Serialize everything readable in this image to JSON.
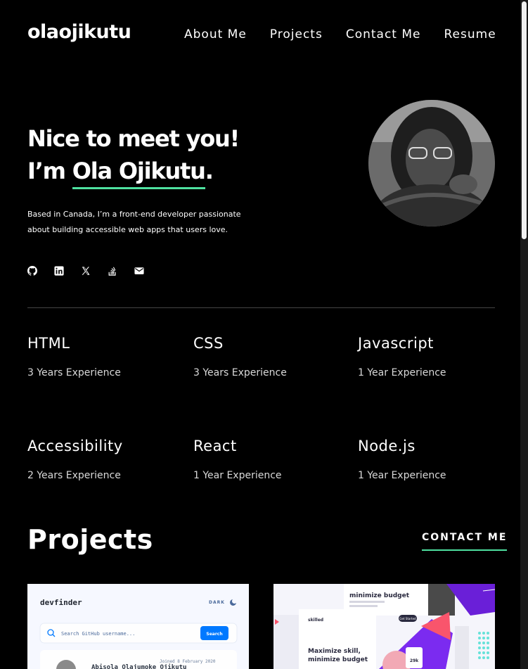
{
  "header": {
    "logo": "olaojikutu",
    "nav": [
      "About Me",
      "Projects",
      "Contact Me",
      "Resume"
    ]
  },
  "hero": {
    "line1": "Nice to meet you!",
    "line2_prefix": "I’m ",
    "name": "Ola Ojikutu",
    "line2_suffix": ".",
    "bio": "Based in Canada, I’m a front-end developer passionate about building accessible web apps that users love."
  },
  "socials": [
    "github-icon",
    "linkedin-icon",
    "x-icon",
    "stackoverflow-icon",
    "email-icon"
  ],
  "skills": [
    {
      "name": "HTML",
      "experience": "3 Years Experience"
    },
    {
      "name": "CSS",
      "experience": "3 Years Experience"
    },
    {
      "name": "Javascript",
      "experience": "1 Year Experience"
    },
    {
      "name": "Accessibility",
      "experience": "2 Years Experience"
    },
    {
      "name": "React",
      "experience": "1 Year Experience"
    },
    {
      "name": "Node.js",
      "experience": "1 Year Experience"
    }
  ],
  "projects": {
    "title": "Projects",
    "contact_label": "CONTACT ME",
    "card1": {
      "brand": "devfinder",
      "theme": "DARK",
      "search_placeholder": "Search GitHub username...",
      "search_button": "Search",
      "joined": "Joined 8 February 2020",
      "user_name": "Abisola Olajumoke Ojikutu"
    },
    "card2": {
      "brand": "skilled",
      "cta": "Get Started",
      "headline1": "Maximize skill,",
      "headline2": "minimize budget",
      "top_heading": "minimize budget",
      "stat": "29k"
    }
  },
  "colors": {
    "accent": "#4ee1a0",
    "background": "#000000",
    "text": "#ffffff"
  }
}
